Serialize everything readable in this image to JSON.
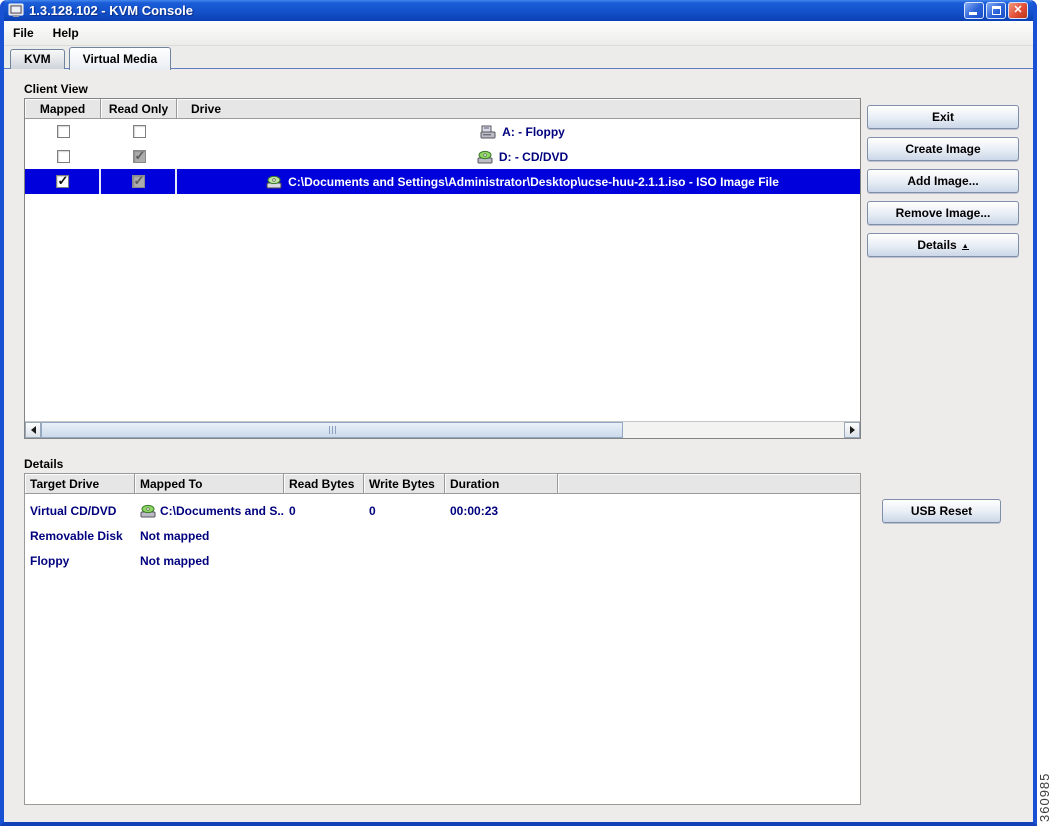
{
  "window": {
    "title": "1.3.128.102 - KVM Console",
    "controls": [
      "minimize",
      "maximize",
      "close"
    ]
  },
  "colors": {
    "titlebar_blue": "#1350C8",
    "window_border": "#1951D5",
    "selection_blue": "#0000DC",
    "row_text_navy": "#00007E"
  },
  "menu": {
    "items": [
      {
        "label": "File"
      },
      {
        "label": "Help"
      }
    ]
  },
  "tabs": [
    {
      "label": "KVM",
      "active": false
    },
    {
      "label": "Virtual Media",
      "active": true
    }
  ],
  "client_view": {
    "section_label": "Client View",
    "columns": [
      "Mapped",
      "Read Only",
      "Drive"
    ],
    "rows": [
      {
        "mapped": false,
        "read_only": false,
        "icon": "floppy-drive-icon",
        "drive": "A: - Floppy",
        "selected": false
      },
      {
        "mapped": false,
        "read_only": true,
        "icon": "cd-drive-icon",
        "drive": "D: - CD/DVD",
        "selected": false
      },
      {
        "mapped": true,
        "read_only": true,
        "icon": "iso-image-icon",
        "drive": "C:\\Documents and Settings\\Administrator\\Desktop\\ucse-huu-2.1.1.iso - ISO Image File",
        "selected": true
      }
    ]
  },
  "buttons": {
    "exit": "Exit",
    "create_image": "Create Image",
    "add_image": "Add Image...",
    "remove_image": "Remove Image...",
    "details": "Details",
    "usb_reset": "USB Reset"
  },
  "details": {
    "section_label": "Details",
    "columns": [
      "Target Drive",
      "Mapped To",
      "Read Bytes",
      "Write Bytes",
      "Duration"
    ],
    "rows": [
      {
        "target": "Virtual CD/DVD",
        "mapped_to": "C:\\Documents and S...",
        "has_icon": true,
        "read_bytes": "0",
        "write_bytes": "0",
        "duration": "00:00:23"
      },
      {
        "target": "Removable Disk",
        "mapped_to": "Not mapped",
        "has_icon": false,
        "read_bytes": "",
        "write_bytes": "",
        "duration": ""
      },
      {
        "target": "Floppy",
        "mapped_to": "Not mapped",
        "has_icon": false,
        "read_bytes": "",
        "write_bytes": "",
        "duration": ""
      }
    ]
  },
  "figure_number": "360985"
}
